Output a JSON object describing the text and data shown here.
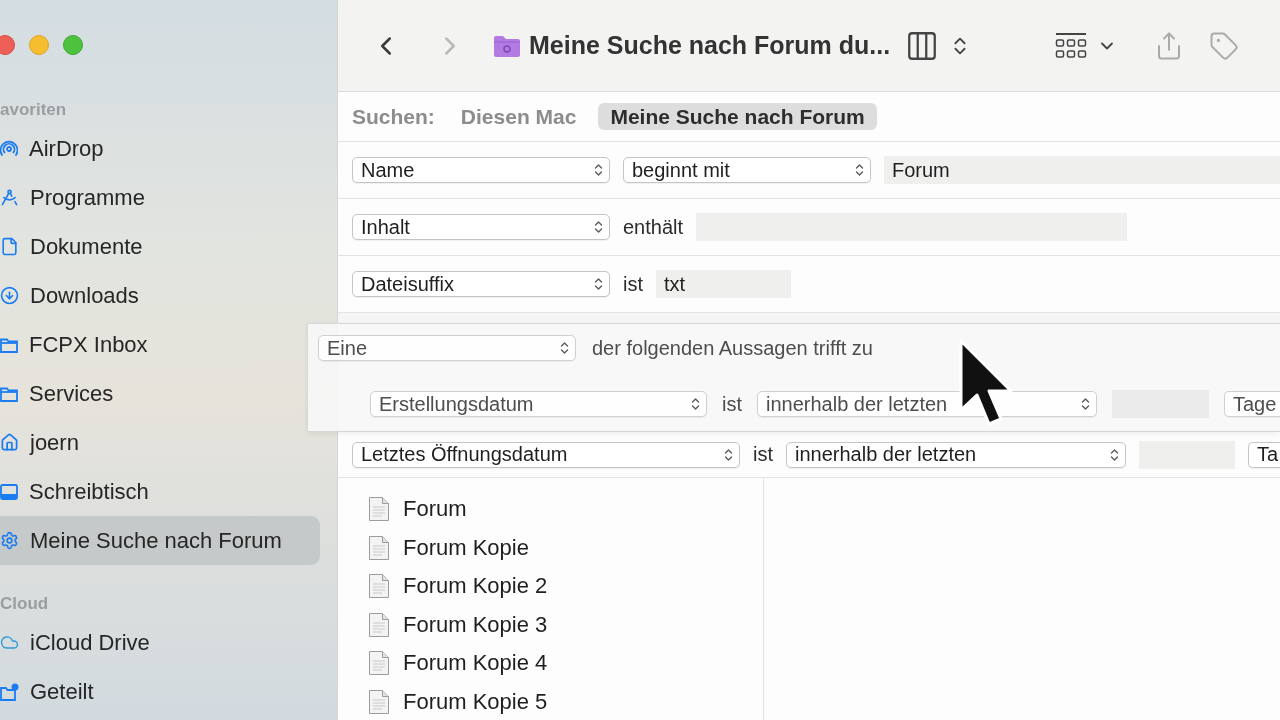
{
  "sidebar": {
    "sections": [
      {
        "title": "avoriten",
        "items": [
          {
            "kind": "airdrop",
            "label": "AirDrop",
            "selected": false
          },
          {
            "kind": "apps",
            "label": "Programme",
            "selected": false
          },
          {
            "kind": "document",
            "label": "Dokumente",
            "selected": false
          },
          {
            "kind": "download",
            "label": "Downloads",
            "selected": false
          },
          {
            "kind": "folder",
            "label": "FCPX Inbox",
            "selected": false
          },
          {
            "kind": "folder",
            "label": "Services",
            "selected": false
          },
          {
            "kind": "home",
            "label": "joern",
            "selected": false
          },
          {
            "kind": "desktop",
            "label": "Schreibtisch",
            "selected": false
          },
          {
            "kind": "smart-folder",
            "label": "Meine Suche nach Forum",
            "selected": true
          }
        ]
      },
      {
        "title": "Cloud",
        "items": [
          {
            "kind": "cloud",
            "label": "iCloud Drive",
            "selected": false
          },
          {
            "kind": "shared",
            "label": "Geteilt",
            "selected": false
          }
        ]
      }
    ]
  },
  "toolbar": {
    "navigation": [
      {
        "kind": "back",
        "disabled": false
      },
      {
        "kind": "forward",
        "disabled": true
      }
    ],
    "title": "Meine Suche nach Forum du..."
  },
  "search_scope": {
    "label": "Suchen:",
    "scopes": [
      {
        "label": "Diesen Mac",
        "selected": false
      },
      {
        "label": "Meine Suche nach Forum",
        "selected": true
      }
    ]
  },
  "criteria": [
    {
      "kind": "rule",
      "parts": [
        {
          "kind": "popup",
          "text": "Name"
        },
        {
          "kind": "popup",
          "text": "beginnt mit"
        },
        {
          "kind": "field",
          "value": "Forum"
        }
      ]
    },
    {
      "kind": "rule",
      "parts": [
        {
          "kind": "popup",
          "text": "Inhalt"
        },
        {
          "kind": "label",
          "text": "enthält"
        },
        {
          "kind": "field"
        }
      ]
    },
    {
      "kind": "rule",
      "parts": [
        {
          "kind": "popup",
          "text": "Dateisuffix"
        },
        {
          "kind": "label",
          "text": "ist"
        },
        {
          "kind": "field",
          "value": "txt"
        }
      ]
    },
    {
      "kind": "group",
      "dragging": true,
      "parts": [
        {
          "kind": "popup",
          "text": "Eine"
        },
        {
          "kind": "label",
          "text": "der folgenden Aussagen trifft zu"
        }
      ],
      "children": [
        {
          "kind": "rule",
          "parts": [
            {
              "kind": "popup",
              "text": "Erstellungsdatum"
            },
            {
              "kind": "label",
              "text": "ist"
            },
            {
              "kind": "popup",
              "text": "innerhalb der letzten"
            },
            {
              "kind": "field"
            },
            {
              "kind": "popup",
              "text": "Tage"
            }
          ]
        }
      ]
    },
    {
      "kind": "rule",
      "parts": [
        {
          "kind": "popup",
          "text": "Letztes Öffnungsdatum"
        },
        {
          "kind": "label",
          "text": "ist"
        },
        {
          "kind": "popup",
          "text": "innerhalb der letzten"
        },
        {
          "kind": "field"
        },
        {
          "kind": "popup",
          "text": "Ta"
        }
      ]
    }
  ],
  "files": [
    {
      "name": "Forum"
    },
    {
      "name": "Forum Kopie"
    },
    {
      "name": "Forum Kopie 2"
    },
    {
      "name": "Forum Kopie 3"
    },
    {
      "name": "Forum Kopie 4"
    },
    {
      "name": "Forum Kopie 5"
    }
  ]
}
